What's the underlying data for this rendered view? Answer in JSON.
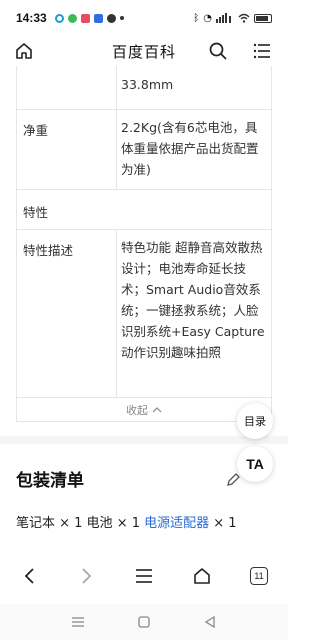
{
  "status": {
    "time": "14:33",
    "icons": [
      "qq-icon",
      "browser-icon",
      "video-icon",
      "baidu-icon",
      "wechat-icon",
      "dot-icon"
    ],
    "right": [
      "bluetooth-icon",
      "alarm-icon",
      "signal-icon",
      "wifi-icon",
      "battery-icon"
    ]
  },
  "header": {
    "title": "百度百科"
  },
  "table": {
    "rows": [
      {
        "key": "",
        "value": "33.8mm"
      },
      {
        "key": "净重",
        "value": "2.2Kg(含有6芯电池，具体重量依据产品出货配置为准)"
      },
      {
        "key": "特性",
        "value": ""
      },
      {
        "key": "特性描述",
        "value": "特色功能 超静音高效散热设计；电池寿命延长技术；Smart Audio音效系统；一键拯救系统；人脸识别系统+Easy Capture动作识别趣味拍照"
      }
    ],
    "collapse_label": "收起"
  },
  "fab": {
    "toc": "目录",
    "ta": "TA"
  },
  "section": {
    "title": "包装清单"
  },
  "package": {
    "part1": "笔记本 × 1 电池 × 1 ",
    "link": "电源适配器",
    "part2": " × 1"
  },
  "bottom_nav": {
    "tabs_count": "11"
  }
}
